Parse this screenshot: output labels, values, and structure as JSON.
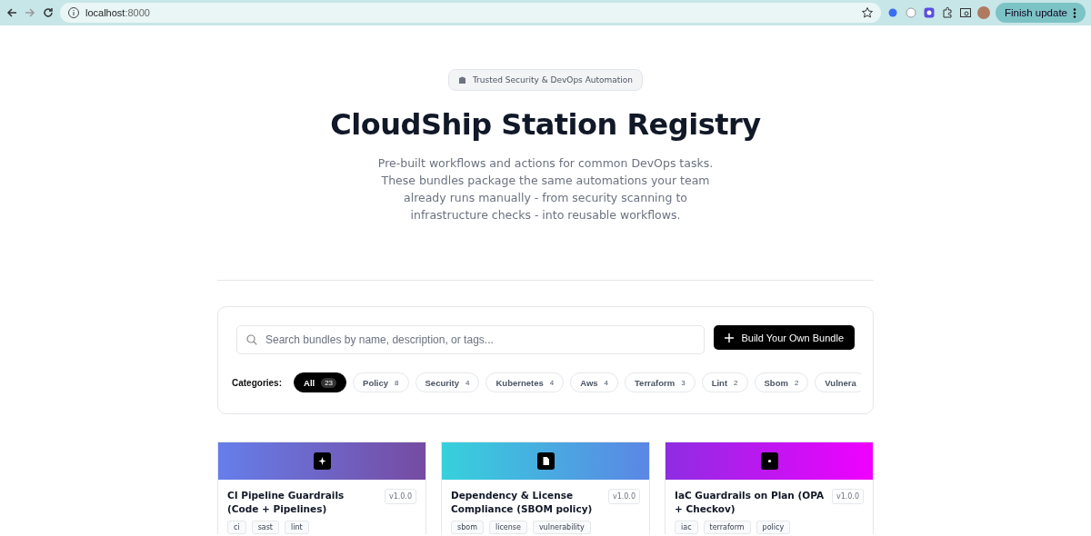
{
  "browser": {
    "url_host": "localhost",
    "url_port": ":8000",
    "update_button": "Finish update"
  },
  "hero": {
    "badge": "Trusted Security & DevOps Automation",
    "title": "CloudShip Station Registry",
    "description": "Pre-built workflows and actions for common DevOps tasks. These bundles package the same automations your team already runs manually - from security scanning to infrastructure checks - into reusable workflows."
  },
  "search": {
    "placeholder": "Search bundles by name, description, or tags...",
    "build_button": "Build Your Own Bundle"
  },
  "categories": {
    "label": "Categories:",
    "items": [
      {
        "name": "All",
        "count": "23",
        "selected": true
      },
      {
        "name": "Policy",
        "count": "8",
        "selected": false
      },
      {
        "name": "Security",
        "count": "4",
        "selected": false
      },
      {
        "name": "Kubernetes",
        "count": "4",
        "selected": false
      },
      {
        "name": "Aws",
        "count": "4",
        "selected": false
      },
      {
        "name": "Terraform",
        "count": "3",
        "selected": false
      },
      {
        "name": "Lint",
        "count": "2",
        "selected": false
      },
      {
        "name": "Sbom",
        "count": "2",
        "selected": false
      },
      {
        "name": "Vulnera",
        "selected": false
      }
    ]
  },
  "bundles": [
    {
      "title": "CI Pipeline Guardrails (Code + Pipelines)",
      "version": "v1.0.0",
      "kind": "sparkle",
      "tags": [
        "ci",
        "sast",
        "lint"
      ]
    },
    {
      "title": "Dependency & License Compliance (SBOM policy)",
      "version": "v1.0.0",
      "kind": "document",
      "tags": [
        "sbom",
        "license",
        "vulnerability"
      ]
    },
    {
      "title": "IaC Guardrails on Plan (OPA + Checkov)",
      "version": "v1.0.0",
      "kind": "dot",
      "tags": [
        "iac",
        "terraform",
        "policy"
      ]
    }
  ]
}
